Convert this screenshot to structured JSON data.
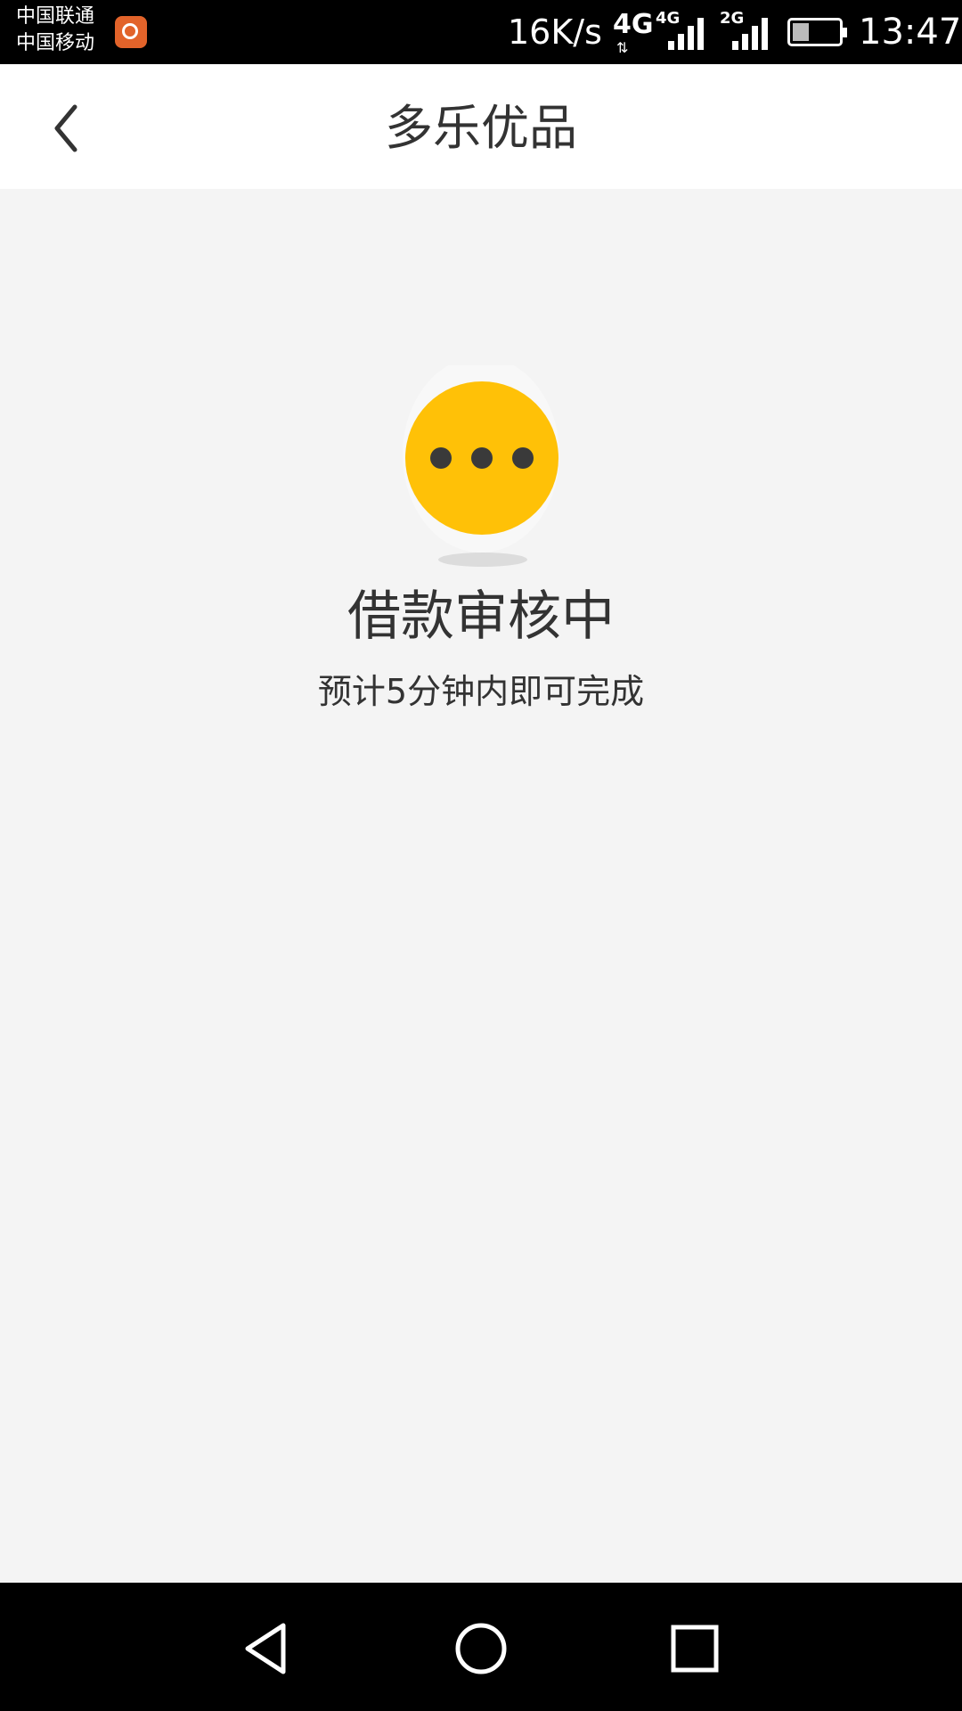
{
  "status_bar": {
    "carrier_1": "中国联通",
    "carrier_2": "中国移动",
    "net_speed": "16K/s",
    "net_type_main": "4G",
    "net_type_sim1": "4G",
    "net_type_sim2": "2G",
    "time": "13:47",
    "battery_level": 0.35
  },
  "header": {
    "title": "多乐优品",
    "back_icon": "chevron-left-icon"
  },
  "main": {
    "status_icon": "pending-dots-icon",
    "status_title": "借款审核中",
    "status_subtitle": "预计5分钟内即可完成",
    "accent_color": "#ffc107"
  },
  "nav_bar": {
    "back_icon": "triangle-back-icon",
    "home_icon": "circle-home-icon",
    "recents_icon": "square-recents-icon"
  }
}
